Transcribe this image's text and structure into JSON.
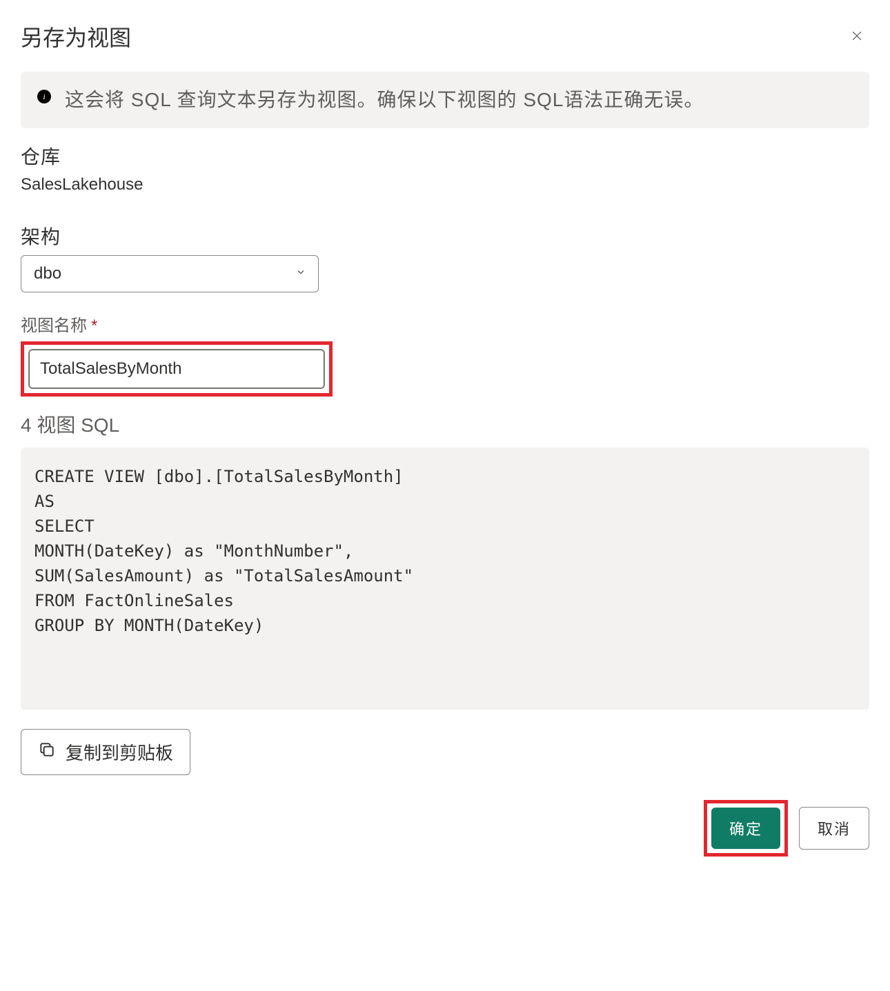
{
  "dialog": {
    "title": "另存为视图",
    "info_text": "这会将 SQL 查询文本另存为视图。确保以下视图的 SQL语法正确无误。"
  },
  "warehouse": {
    "label": "仓库",
    "value": "SalesLakehouse"
  },
  "schema": {
    "label": "架构",
    "value": "dbo"
  },
  "view_name": {
    "label": "视图名称",
    "value": "TotalSalesByMonth"
  },
  "sql": {
    "label": "4 视图 SQL",
    "content": "CREATE VIEW [dbo].[TotalSalesByMonth]\nAS\nSELECT\nMONTH(DateKey) as \"MonthNumber\",\nSUM(SalesAmount) as \"TotalSalesAmount\"\nFROM FactOnlineSales\nGROUP BY MONTH(DateKey)"
  },
  "buttons": {
    "copy": "复制到剪贴板",
    "ok": "确定",
    "cancel": "取消"
  }
}
